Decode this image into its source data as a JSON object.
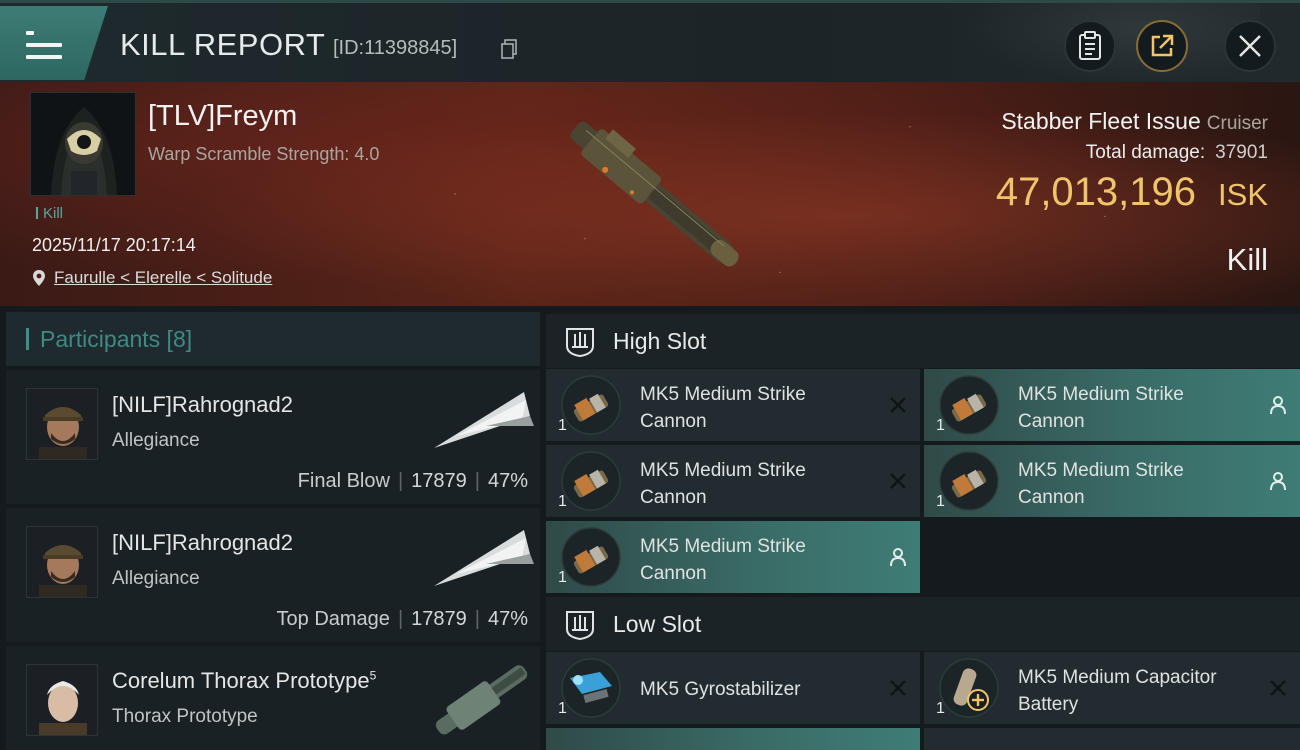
{
  "header": {
    "title": "KILL REPORT",
    "report_id": "[ID:11398845]",
    "icons": [
      "menu-icon",
      "copy-icon",
      "clipboard-icon",
      "share-icon",
      "close-icon"
    ]
  },
  "hero": {
    "pilot_name": "[TLV]Freym",
    "warp_scramble": "Warp Scramble Strength: 4.0",
    "kill_tag": "Kill",
    "date": "2025/11/17 20:17:14",
    "location": "Faurulle < Elerelle < Solitude",
    "ship_name": "Stabber Fleet Issue",
    "ship_class": "Cruiser",
    "total_damage_label": "Total damage:",
    "total_damage_value": "37901",
    "isk_value": "47,013,196",
    "isk_unit": "ISK",
    "result": "Kill"
  },
  "participants": {
    "title": "Participants [8]",
    "rows": [
      {
        "name": "[NILF]Rahrognad2",
        "ship": "Allegiance",
        "label": "Final Blow",
        "damage": "17879",
        "percent": "47%"
      },
      {
        "name": "[NILF]Rahrognad2",
        "ship": "Allegiance",
        "label": "Top Damage",
        "damage": "17879",
        "percent": "47%"
      },
      {
        "name": "Corelum Thorax Prototype",
        "sup": "5",
        "ship": "Thorax Prototype"
      }
    ]
  },
  "fitting": {
    "high_slot_title": "High Slot",
    "low_slot_title": "Low Slot",
    "high_slot": [
      {
        "name": "MK5 Medium Strike Cannon",
        "qty": "1",
        "status": "destroyed"
      },
      {
        "name": "MK5 Medium Strike Cannon",
        "qty": "1",
        "status": "dropped"
      },
      {
        "name": "MK5 Medium Strike Cannon",
        "qty": "1",
        "status": "destroyed"
      },
      {
        "name": "MK5 Medium Strike Cannon",
        "qty": "1",
        "status": "dropped"
      },
      {
        "name": "MK5 Medium Strike Cannon",
        "qty": "1",
        "status": "dropped"
      }
    ],
    "low_slot": [
      {
        "name": "MK5 Gyrostabilizer",
        "qty": "1",
        "status": "destroyed"
      },
      {
        "name": "MK5 Medium Capacitor Battery",
        "qty": "1",
        "status": "destroyed"
      }
    ]
  },
  "colors": {
    "accent_teal": "#3e8f87",
    "isk_gold": "#f0c46a",
    "highlight": "#3f7c76"
  }
}
